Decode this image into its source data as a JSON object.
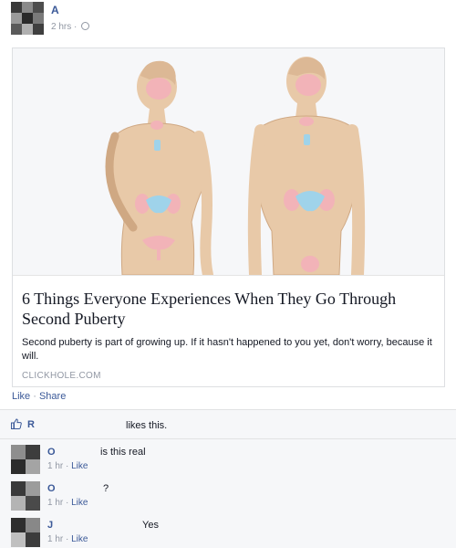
{
  "post": {
    "author": "A",
    "time": "2 hrs",
    "meta_sep": " · "
  },
  "link_card": {
    "title": "6 Things Everyone Experiences When They Go Through Second Puberty",
    "description": "Second puberty is part of growing up. If it hasn't happened to you yet, don't worry, because it will.",
    "domain": "CLICKHOLE.COM"
  },
  "actions": {
    "like": "Like",
    "sep": " · ",
    "share": "Share"
  },
  "likes": {
    "name": "R",
    "text": "likes this."
  },
  "comments": [
    {
      "name": "O",
      "text": "is this real",
      "time": "1 hr",
      "sep": " · ",
      "like": "Like"
    },
    {
      "name": "O",
      "text": "?",
      "time": "1 hr",
      "sep": " · ",
      "like": "Like"
    },
    {
      "name": "J",
      "text": "Yes",
      "time": "1 hr",
      "sep": " · ",
      "like": "Like"
    }
  ],
  "colors": {
    "link": "#3b5998",
    "meta": "#9197a3",
    "ufi_bg": "#f6f7f9",
    "skin": "#e8c9a8",
    "organ_pink": "#f2b3b8",
    "organ_blue": "#9fd3ea"
  }
}
